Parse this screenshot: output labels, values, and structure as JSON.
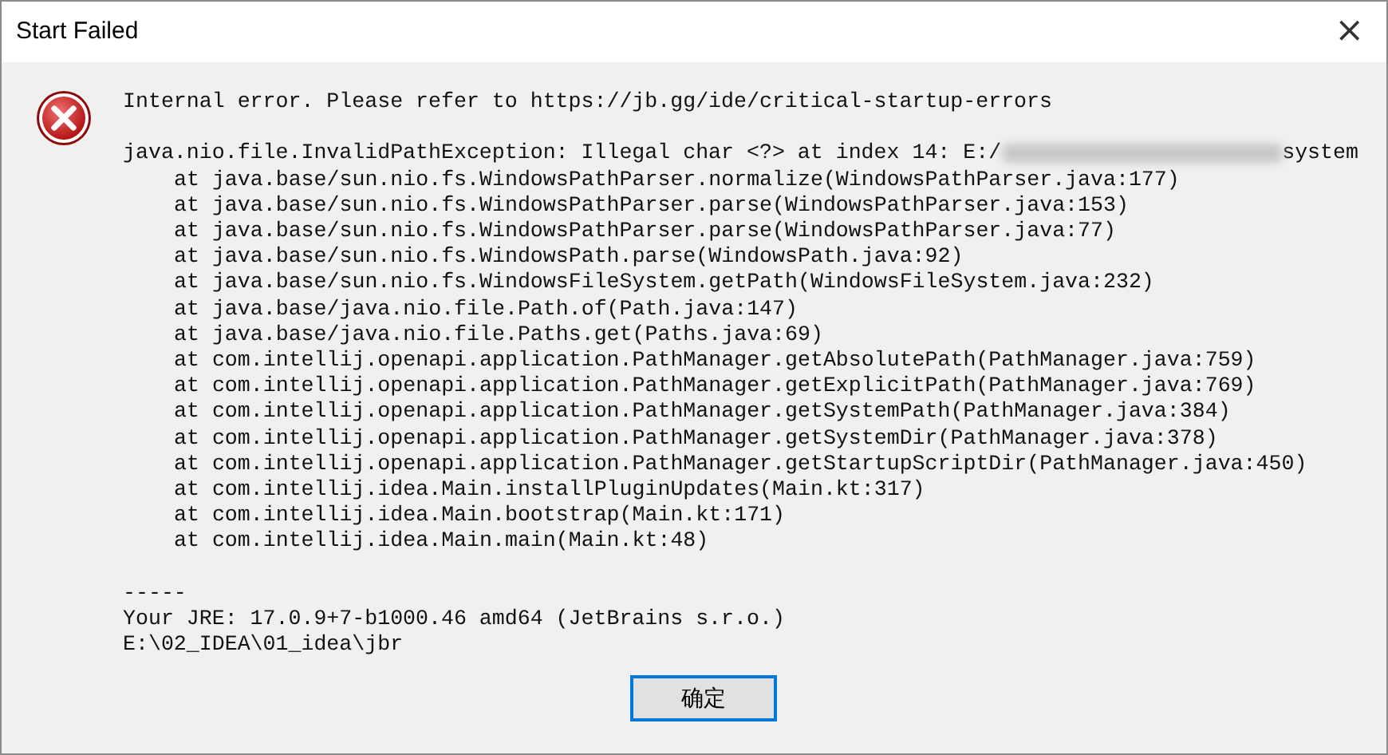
{
  "window": {
    "title": "Start Failed",
    "close": "×"
  },
  "message": "Internal error. Please refer to https://jb.gg/ide/critical-startup-errors",
  "trace": [
    {
      "kind": "exception",
      "text": "java.nio.file.InvalidPathException: Illegal char <?> at index 14: E:/",
      "tail": "system"
    },
    {
      "kind": "frame",
      "text": "at java.base/sun.nio.fs.WindowsPathParser.normalize(WindowsPathParser.java:177)"
    },
    {
      "kind": "frame",
      "text": "at java.base/sun.nio.fs.WindowsPathParser.parse(WindowsPathParser.java:153)"
    },
    {
      "kind": "frame",
      "text": "at java.base/sun.nio.fs.WindowsPathParser.parse(WindowsPathParser.java:77)"
    },
    {
      "kind": "frame",
      "text": "at java.base/sun.nio.fs.WindowsPath.parse(WindowsPath.java:92)"
    },
    {
      "kind": "frame",
      "text": "at java.base/sun.nio.fs.WindowsFileSystem.getPath(WindowsFileSystem.java:232)"
    },
    {
      "kind": "frame",
      "text": "at java.base/java.nio.file.Path.of(Path.java:147)"
    },
    {
      "kind": "frame",
      "text": "at java.base/java.nio.file.Paths.get(Paths.java:69)"
    },
    {
      "kind": "frame",
      "text": "at com.intellij.openapi.application.PathManager.getAbsolutePath(PathManager.java:759)"
    },
    {
      "kind": "frame",
      "text": "at com.intellij.openapi.application.PathManager.getExplicitPath(PathManager.java:769)"
    },
    {
      "kind": "frame",
      "text": "at com.intellij.openapi.application.PathManager.getSystemPath(PathManager.java:384)"
    },
    {
      "kind": "frame",
      "text": "at com.intellij.openapi.application.PathManager.getSystemDir(PathManager.java:378)"
    },
    {
      "kind": "frame",
      "text": "at com.intellij.openapi.application.PathManager.getStartupScriptDir(PathManager.java:450)"
    },
    {
      "kind": "frame",
      "text": "at com.intellij.idea.Main.installPluginUpdates(Main.kt:317)"
    },
    {
      "kind": "frame",
      "text": "at com.intellij.idea.Main.bootstrap(Main.kt:171)"
    },
    {
      "kind": "frame",
      "text": "at com.intellij.idea.Main.main(Main.kt:48)"
    }
  ],
  "footer": [
    "-----",
    "Your JRE: 17.0.9+7-b1000.46 amd64 (JetBrains s.r.o.)",
    "E:\\02_IDEA\\01_idea\\jbr"
  ],
  "ok_button": "确定"
}
